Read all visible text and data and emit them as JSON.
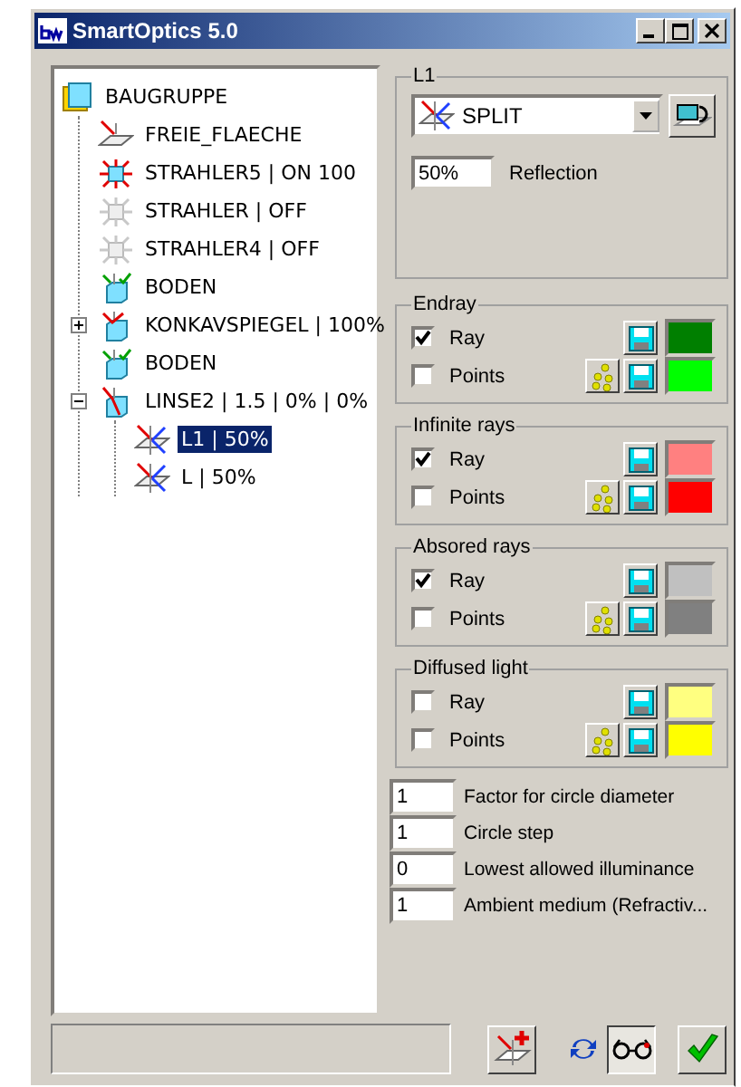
{
  "window": {
    "title": "SmartOptics 5.0"
  },
  "tree": [
    {
      "label": "BAUGRUPPE",
      "kind": "folder",
      "selected": false,
      "children": [
        {
          "label": "FREIE_FLAECHE",
          "kind": "surface",
          "selected": false
        },
        {
          "label": "STRAHLER5 | ON 100",
          "kind": "source_on",
          "selected": false
        },
        {
          "label": "STRAHLER | OFF",
          "kind": "source_off",
          "selected": false
        },
        {
          "label": "STRAHLER4 | OFF",
          "kind": "source_off",
          "selected": false
        },
        {
          "label": "BODEN",
          "kind": "receiver",
          "selected": false
        },
        {
          "label": "KONKAVSPIEGEL | 100%",
          "kind": "mirror",
          "selected": false,
          "expanded": false
        },
        {
          "label": "BODEN",
          "kind": "receiver",
          "selected": false
        },
        {
          "label": "LINSE2 | 1.5 | 0% | 0%",
          "kind": "lens",
          "selected": false,
          "expanded": true,
          "children": [
            {
              "label": "L1 | 50%",
              "kind": "splitter",
              "selected": true
            },
            {
              "label": "L | 50%",
              "kind": "splitter",
              "selected": false
            }
          ]
        }
      ]
    }
  ],
  "properties": {
    "title": "L1",
    "mode": {
      "value": "SPLIT"
    },
    "reflection": {
      "value": "50%",
      "label": "Reflection"
    }
  },
  "ray_groups": [
    {
      "title": "Endray",
      "rows": [
        {
          "kind": "ray",
          "label": "Ray",
          "checked": true,
          "color": "#007f00"
        },
        {
          "kind": "points",
          "label": "Points",
          "checked": false,
          "color": "#00ff00"
        }
      ]
    },
    {
      "title": "Infinite rays",
      "rows": [
        {
          "kind": "ray",
          "label": "Ray",
          "checked": true,
          "color": "#ff8080"
        },
        {
          "kind": "points",
          "label": "Points",
          "checked": false,
          "color": "#ff0000"
        }
      ]
    },
    {
      "title": "Absored rays",
      "rows": [
        {
          "kind": "ray",
          "label": "Ray",
          "checked": true,
          "color": "#c0c0c0"
        },
        {
          "kind": "points",
          "label": "Points",
          "checked": false,
          "color": "#808080"
        }
      ]
    },
    {
      "title": "Diffused light",
      "rows": [
        {
          "kind": "ray",
          "label": "Ray",
          "checked": false,
          "color": "#ffff80"
        },
        {
          "kind": "points",
          "label": "Points",
          "checked": false,
          "color": "#ffff00"
        }
      ]
    }
  ],
  "parameters": [
    {
      "value": "1",
      "label": "Factor for circle diameter"
    },
    {
      "value": "1",
      "label": "Circle step"
    },
    {
      "value": "0",
      "label": "Lowest allowed illuminance"
    },
    {
      "value": "1",
      "label": "Ambient medium (Refractiv..."
    }
  ]
}
